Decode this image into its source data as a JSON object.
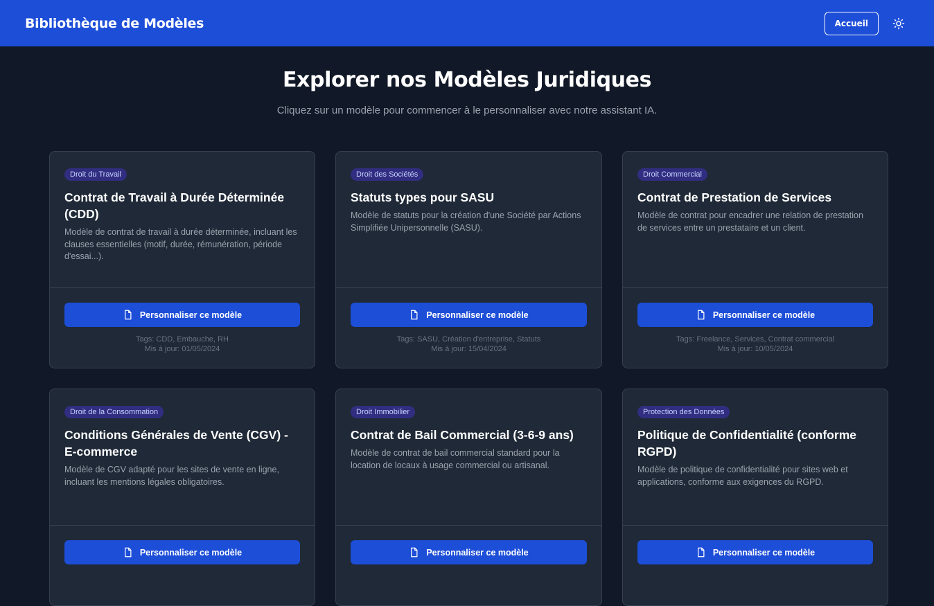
{
  "header": {
    "brand": "Bibliothèque de Modèles",
    "home_label": "Accueil",
    "theme_icon": "sun-icon"
  },
  "hero": {
    "title": "Explorer nos Modèles Juridiques",
    "subtitle": "Cliquez sur un modèle pour commencer à le personnaliser avec notre assistant IA."
  },
  "cards": [
    {
      "category": "Droit du Travail",
      "title": "Contrat de Travail à Durée Déterminée (CDD)",
      "description": "Modèle de contrat de travail à durée déterminée, incluant les clauses essentielles (motif, durée, rémunération, période d'essai...).",
      "cta": "Personnaliser ce modèle",
      "tags": "Tags: CDD, Embauche, RH",
      "updated": "Mis à jour: 01/05/2024"
    },
    {
      "category": "Droit des Sociétés",
      "title": "Statuts types pour SASU",
      "description": "Modèle de statuts pour la création d'une Société par Actions Simplifiée Unipersonnelle (SASU).",
      "cta": "Personnaliser ce modèle",
      "tags": "Tags: SASU, Création d'entreprise, Statuts",
      "updated": "Mis à jour: 15/04/2024"
    },
    {
      "category": "Droit Commercial",
      "title": "Contrat de Prestation de Services",
      "description": "Modèle de contrat pour encadrer une relation de prestation de services entre un prestataire et un client.",
      "cta": "Personnaliser ce modèle",
      "tags": "Tags: Freelance, Services, Contrat commercial",
      "updated": "Mis à jour: 10/05/2024"
    },
    {
      "category": "Droit de la Consommation",
      "title": "Conditions Générales de Vente (CGV) - E-commerce",
      "description": "Modèle de CGV adapté pour les sites de vente en ligne, incluant les mentions légales obligatoires.",
      "cta": "Personnaliser ce modèle",
      "tags": "",
      "updated": ""
    },
    {
      "category": "Droit Immobilier",
      "title": "Contrat de Bail Commercial (3-6-9 ans)",
      "description": "Modèle de contrat de bail commercial standard pour la location de locaux à usage commercial ou artisanal.",
      "cta": "Personnaliser ce modèle",
      "tags": "",
      "updated": ""
    },
    {
      "category": "Protection des Données",
      "title": "Politique de Confidentialité (conforme RGPD)",
      "description": "Modèle de politique de confidentialité pour sites web et applications, conforme aux exigences du RGPD.",
      "cta": "Personnaliser ce modèle",
      "tags": "",
      "updated": ""
    }
  ]
}
